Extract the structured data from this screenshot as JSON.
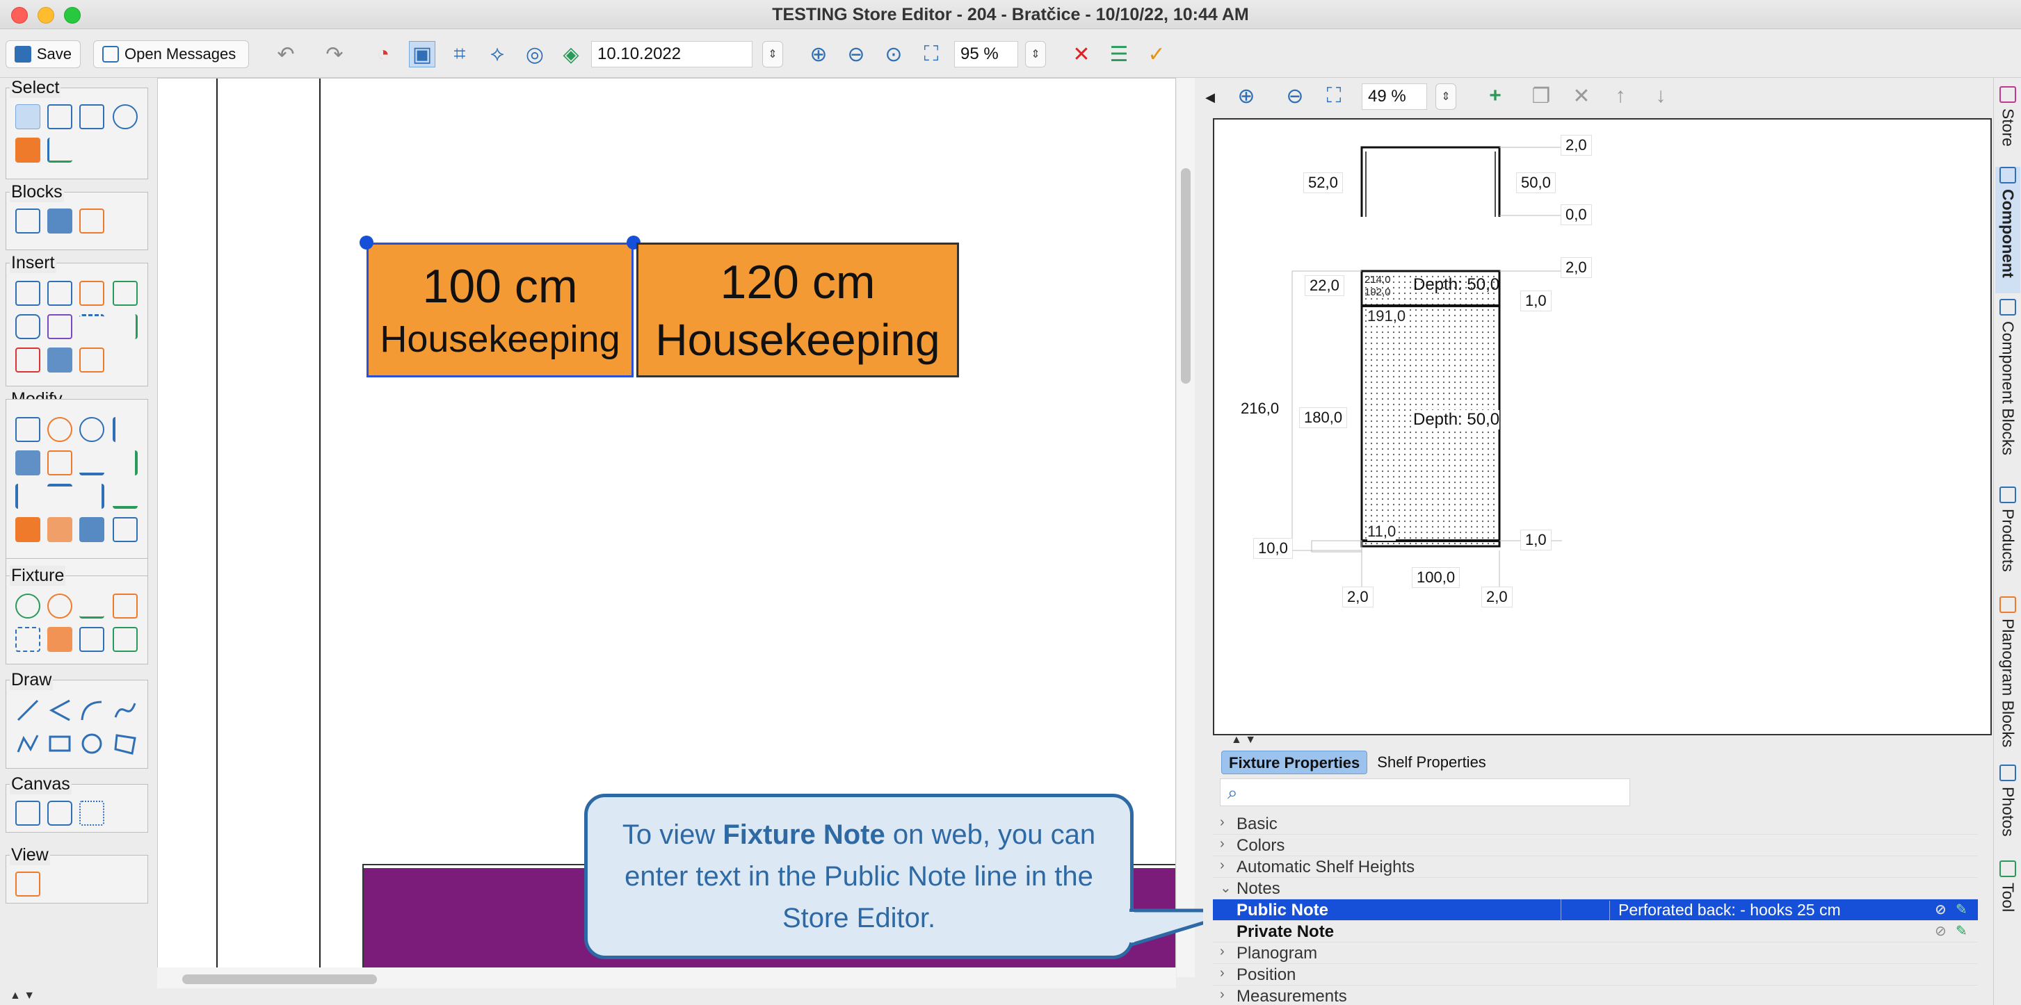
{
  "window": {
    "title": "TESTING Store Editor - 204 - Bratčice - 10/10/22, 10:44 AM"
  },
  "toolbar": {
    "save_label": "Save",
    "open_messages_label": "Open Messages",
    "date_value": "10.10.2022",
    "zoom_value": "95 %"
  },
  "palette": {
    "groups": [
      "Select",
      "Blocks",
      "Insert",
      "Modify",
      "Fixture",
      "Draw",
      "Canvas",
      "View"
    ]
  },
  "canvas": {
    "fixtures": [
      {
        "size": "100 cm",
        "label": "Housekeeping"
      },
      {
        "size": "120 cm",
        "label": "Housekeeping"
      }
    ]
  },
  "callout": {
    "text_before": "To view ",
    "text_bold": "Fixture Note",
    "text_after": " on web, you can enter text in the Public Note line in the Store Editor."
  },
  "component_preview": {
    "zoom_value": "49 %",
    "dims": {
      "top_right_top": "2,0",
      "top_left": "52,0",
      "top_right_mid": "50,0",
      "top_right_bottom": "0,0",
      "mid_right_top": "2,0",
      "left_22": "22,0",
      "small_214": "214,0",
      "small_192": "192,0",
      "depth_top": "Depth: 50,0",
      "right_1a": "1,0",
      "inner_191": "191,0",
      "left_216": "216,0",
      "left_180": "180,0",
      "depth_mid": "Depth: 50,0",
      "inner_11": "11,0",
      "right_1b": "1,0",
      "left_10": "10,0",
      "bottom_100": "100,0",
      "bottom_left_2": "2,0",
      "bottom_right_2": "2,0"
    }
  },
  "properties": {
    "tabs": [
      "Fixture Properties",
      "Shelf Properties"
    ],
    "sections": {
      "basic": "Basic",
      "colors": "Colors",
      "auto_shelf": "Automatic Shelf Heights",
      "notes": "Notes",
      "planogram": "Planogram",
      "position": "Position",
      "measurements": "Measurements"
    },
    "public_note_label": "Public Note",
    "public_note_value": "Perforated back: - hooks 25 cm",
    "private_note_label": "Private Note"
  },
  "side_tabs": [
    "Store",
    "Component",
    "Component Blocks",
    "Products",
    "Planogram Blocks",
    "Photos",
    "Tool"
  ],
  "colors": {
    "accent": "#2f6fb5",
    "fixture_orange": "#f39a35",
    "purple_fixture": "#7b1c7b",
    "selection_blue": "#1750d8"
  }
}
